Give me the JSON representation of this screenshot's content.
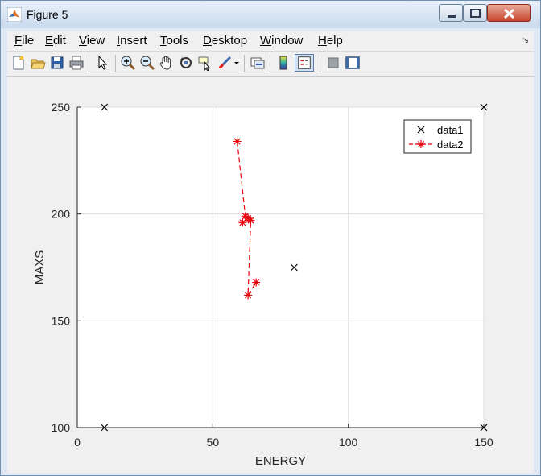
{
  "window": {
    "title": "Figure 5"
  },
  "menubar": {
    "items": [
      {
        "accel": "F",
        "rest": "ile"
      },
      {
        "accel": "E",
        "rest": "dit"
      },
      {
        "accel": "V",
        "rest": "iew"
      },
      {
        "accel": "I",
        "rest": "nsert"
      },
      {
        "accel": "T",
        "rest": "ools"
      },
      {
        "accel": "D",
        "rest": "esktop"
      },
      {
        "accel": "W",
        "rest": "indow"
      },
      {
        "accel": "H",
        "rest": "elp"
      }
    ]
  },
  "toolbar": {
    "icons": [
      "new-figure-icon",
      "open-file-icon",
      "save-icon",
      "print-icon",
      "pointer-icon",
      "zoom-in-icon",
      "zoom-out-icon",
      "pan-hand-icon",
      "rotate-3d-icon",
      "data-cursor-icon",
      "brush-icon",
      "brush-dropdown-icon",
      "link-plot-icon",
      "colorbar-icon",
      "legend-icon",
      "hide-plot-tools-icon",
      "show-plot-tools-icon"
    ]
  },
  "colors": {
    "data1": "#000000",
    "data2": "#e8000b",
    "grid": "#dcdcdc"
  },
  "chart_data": {
    "type": "scatter",
    "xlabel": "ENERGY",
    "ylabel": "MAXS",
    "xlim": [
      0,
      150
    ],
    "ylim": [
      100,
      250
    ],
    "xticks": [
      0,
      50,
      100,
      150
    ],
    "yticks": [
      100,
      150,
      200,
      250
    ],
    "grid": true,
    "legend_position": "top-right",
    "series": [
      {
        "name": "data1",
        "marker": "x",
        "line": "none",
        "x": [
          10,
          150,
          80,
          10,
          150
        ],
        "y": [
          250,
          250,
          175,
          100,
          100
        ]
      },
      {
        "name": "data2",
        "marker": "*",
        "line": "dashed",
        "x": [
          59,
          62,
          63,
          61,
          64,
          63,
          66
        ],
        "y": [
          234,
          199,
          198,
          196,
          197,
          162,
          168
        ]
      }
    ]
  }
}
